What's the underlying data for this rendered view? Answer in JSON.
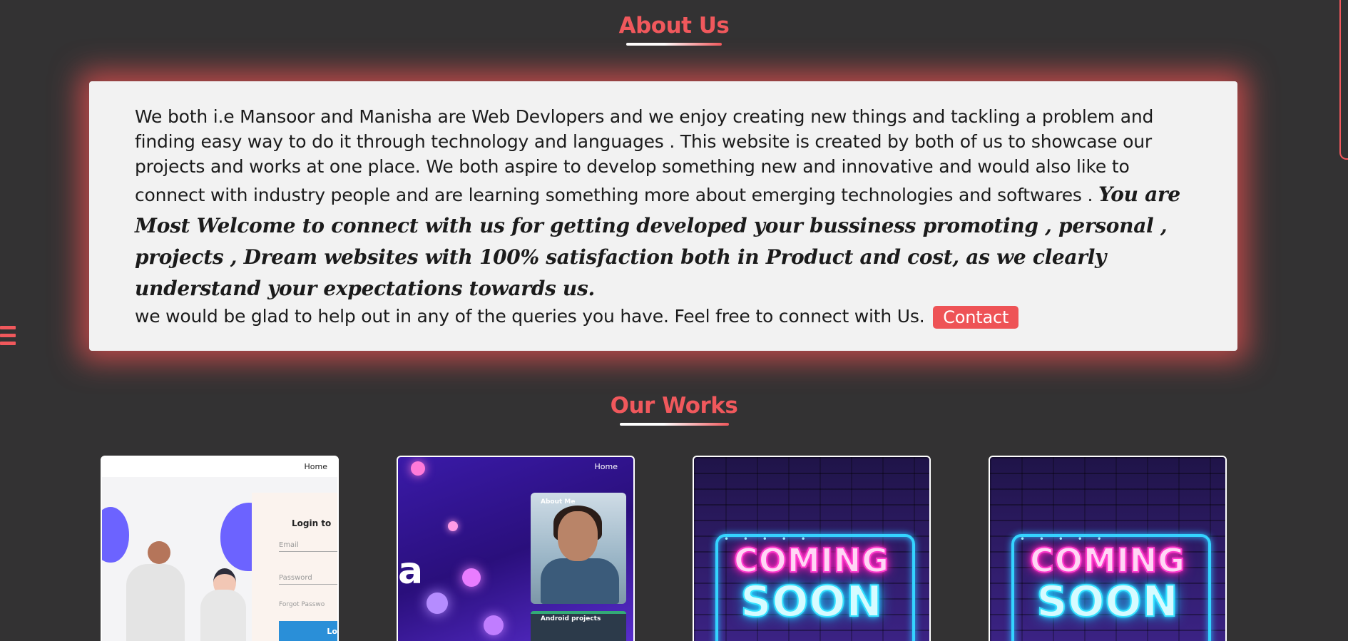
{
  "about": {
    "title": "About Us",
    "paragraph": "We both i.e Mansoor and Manisha are Web Devlopers and we enjoy creating new things and tackling a problem and finding easy way to do it through technology and languages . This website is created by both of us to showcase our projects and works at one place. We both aspire to develop something new and innovative and would also like to connect with industry people and are learning something more about emerging technologies and softwares . ",
    "highlight": "You are Most Welcome to connect with us for getting developed your bussiness promoting , personal , projects , Dream websites with 100% satisfaction both in Product and cost, as we clearly understand your expectations towards us.",
    "closing": "we would be glad to help out in any of the queries you have. Feel free to connect with Us. ",
    "contact_label": "Contact"
  },
  "works": {
    "title": "Our Works",
    "cards": [
      {
        "nav_home": "Home",
        "form_title": "Login to",
        "email_placeholder": "Email",
        "password_placeholder": "Password",
        "forgot": "Forgot Passwo",
        "button": "Lo"
      },
      {
        "nav_home": "Home",
        "partial_letter": "a",
        "about_label": "About Me",
        "android_label": "Android projects"
      },
      {
        "line1": "COMING",
        "line2": "SOON",
        "dots": "• • • • •"
      },
      {
        "line1": "COMING",
        "line2": "SOON",
        "dots": "• • • • •"
      }
    ]
  },
  "icons": {
    "menu": "hamburger-menu-icon"
  },
  "colors": {
    "background": "#333233",
    "accent": "#f0585c",
    "card": "#f2f2f2",
    "neon_pink": "#ff3ccd",
    "neon_blue": "#36e2ff"
  }
}
